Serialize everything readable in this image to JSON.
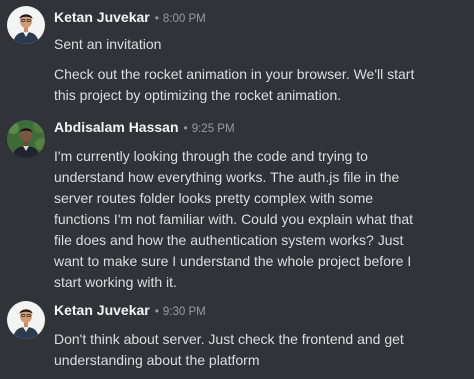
{
  "messages": [
    {
      "author": "Ketan Juvekar",
      "separator": "•",
      "time": "8:00 PM",
      "avatar_icon": "user-avatar-ketan",
      "lines": [
        "Sent an invitation",
        "Check out the rocket animation in your browser. We'll start",
        "this project by optimizing the rocket animation."
      ]
    },
    {
      "author": "Abdisalam Hassan",
      "separator": "•",
      "time": "9:25 PM",
      "avatar_icon": "user-avatar-abdisalam",
      "lines": [
        "I'm currently looking through the code and trying to",
        "understand how everything works. The auth.js file in the",
        "server routes folder looks pretty complex with some",
        "functions I'm not familiar with. Could you explain what that",
        "file does and how the authentication system works? Just",
        "want to make sure I understand the whole project before I",
        "start working with it."
      ]
    },
    {
      "author": "Ketan Juvekar",
      "separator": "•",
      "time": "9:30 PM",
      "avatar_icon": "user-avatar-ketan",
      "lines": [
        "Don't think about server. Just check the frontend and get",
        "understanding about the platform"
      ]
    }
  ],
  "colors": {
    "background": "#313338",
    "author": "#f2f3f5",
    "text": "#dbdee1",
    "timestamp": "#949ba4"
  }
}
